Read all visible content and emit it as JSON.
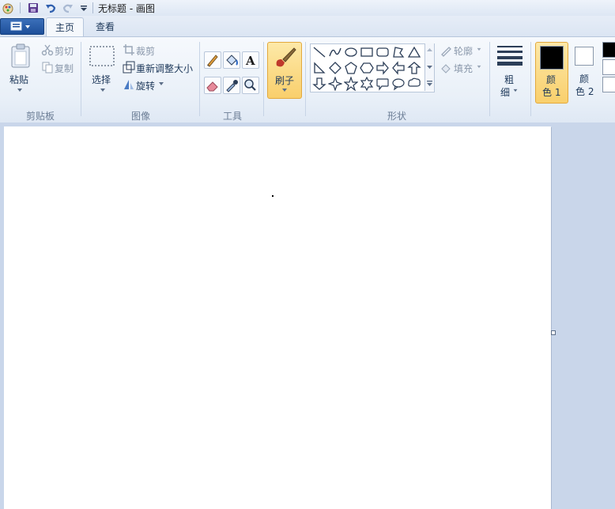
{
  "window": {
    "title": "无标题 - 画图"
  },
  "tabs": [
    {
      "label": "主页",
      "active": true
    },
    {
      "label": "查看",
      "active": false
    }
  ],
  "clipboard": {
    "paste_label": "粘贴",
    "cut_label": "剪切",
    "copy_label": "复制",
    "group_label": "剪贴板"
  },
  "image": {
    "select_label": "选择",
    "crop_label": "裁剪",
    "resize_label": "重新调整大小",
    "rotate_label": "旋转",
    "group_label": "图像"
  },
  "tools": {
    "group_label": "工具",
    "items": [
      "pencil-icon",
      "fill-bucket-icon",
      "text-icon",
      "eraser-icon",
      "color-picker-icon",
      "magnifier-icon"
    ]
  },
  "brushes": {
    "label": "刷子"
  },
  "shapes": {
    "group_label": "形状",
    "outline_label": "轮廓",
    "fill_label": "填充"
  },
  "size": {
    "label_line1": "粗",
    "label_line2": "细"
  },
  "colors": {
    "color1_line1": "颜",
    "color1_line2": "色 1",
    "color2_line1": "颜",
    "color2_line2": "色 2",
    "color1": "#000000",
    "color2": "#ffffff"
  }
}
